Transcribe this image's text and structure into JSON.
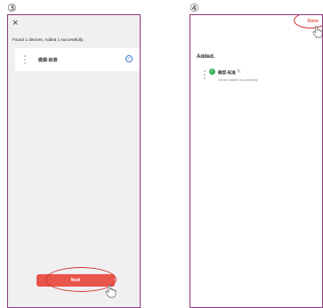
{
  "steps": [
    "③",
    "④"
  ],
  "screen3": {
    "close_glyph": "×",
    "found_message": "Found 1 devices. Added 1 successfully.",
    "device_name": "微菜-标准",
    "check_glyph": "✓",
    "next_label": "Next"
  },
  "screen4": {
    "done_label": "Done",
    "added_title": "Added.",
    "check_glyph": "✓",
    "device_name": "微菜-标准",
    "edit_glyph": "✎",
    "status_text": "Device added successfully"
  },
  "colors": {
    "accent": "#e8554a",
    "highlight_ellipse": "#d0342c",
    "success": "#3cb062",
    "check_blue": "#3b78d8",
    "phone_border": "#8b3a7e"
  }
}
